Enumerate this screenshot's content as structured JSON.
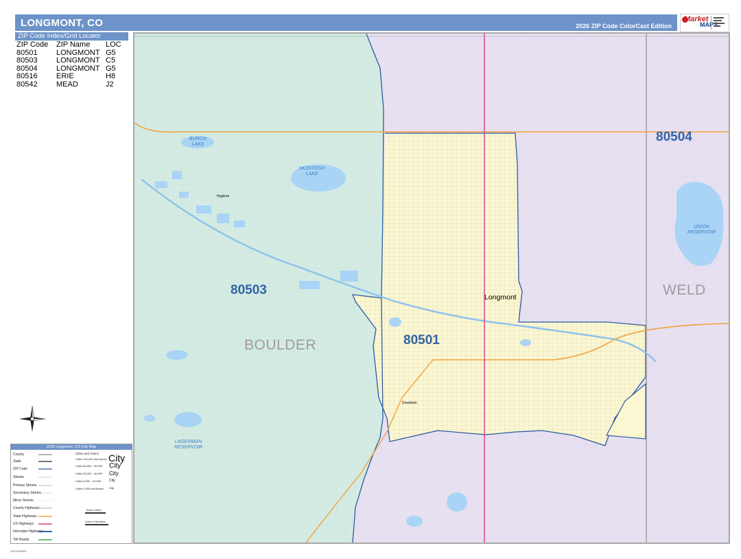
{
  "header": {
    "title": "LONGMONT, CO",
    "edition": "2026 ZIP Code ColorCast Edition"
  },
  "logo": {
    "brand_line1": "Market",
    "brand_line2": "MAPS"
  },
  "zip_index": {
    "title": "ZIP Code Index/Grid Locator",
    "columns": [
      "ZIP Code",
      "ZIP Name",
      "LOC"
    ],
    "rows": [
      [
        "80501",
        "LONGMONT",
        "G5"
      ],
      [
        "80503",
        "LONGMONT",
        "C5"
      ],
      [
        "80504",
        "LONGMONT",
        "G5"
      ],
      [
        "80516",
        "ERIE",
        "H8"
      ],
      [
        "80542",
        "MEAD",
        "J2"
      ]
    ]
  },
  "map": {
    "zip_labels": [
      "80503",
      "80501",
      "80504"
    ],
    "county_labels": [
      "BOULDER",
      "WELD"
    ],
    "city_label": "Longmont",
    "town_labels": [
      "Hygiene",
      "Dowdown"
    ],
    "water_labels": [
      [
        "BURCH",
        "LAKE"
      ],
      [
        "MCINTOSH",
        "LAKE"
      ],
      [
        "UNION",
        "RESERVOIR"
      ],
      [
        "LAGERMAN",
        "RESERVOIR"
      ]
    ],
    "colors": {
      "zip_80503": "#d3ebe3",
      "zip_80501": "#fbf7d2",
      "zip_80504": "#e6e0f1",
      "water": "#a9d4f5",
      "zip_boundary": "#2c5aa0",
      "us_highway": "#e0388a",
      "state_highway": "#f3a13c",
      "county_line": "#9a9a9a"
    }
  },
  "legend": {
    "title": "2026 Longmont, CO City Map",
    "items": [
      "County",
      "State",
      "ZIP Code",
      "Streets",
      "Primary Streets",
      "Secondary Streets",
      "Minor Streets",
      "County Highways",
      "State Highways",
      "US Highways",
      "Interstate Highways",
      "Toll Roads"
    ],
    "cities_header": "Cities and Towns",
    "city_sizes": [
      "Cities 100,000 and Above",
      "Cities 50,000 - 99,999",
      "Cities 25,000 - 49,999",
      "Cities 5,000 - 24,999",
      "Cities 4,999 and Below"
    ],
    "city_sample": "City",
    "scale_miles": "Scale in Miles",
    "scale_km": "Scale in Kilometers"
  },
  "footer": "2027876WHL"
}
